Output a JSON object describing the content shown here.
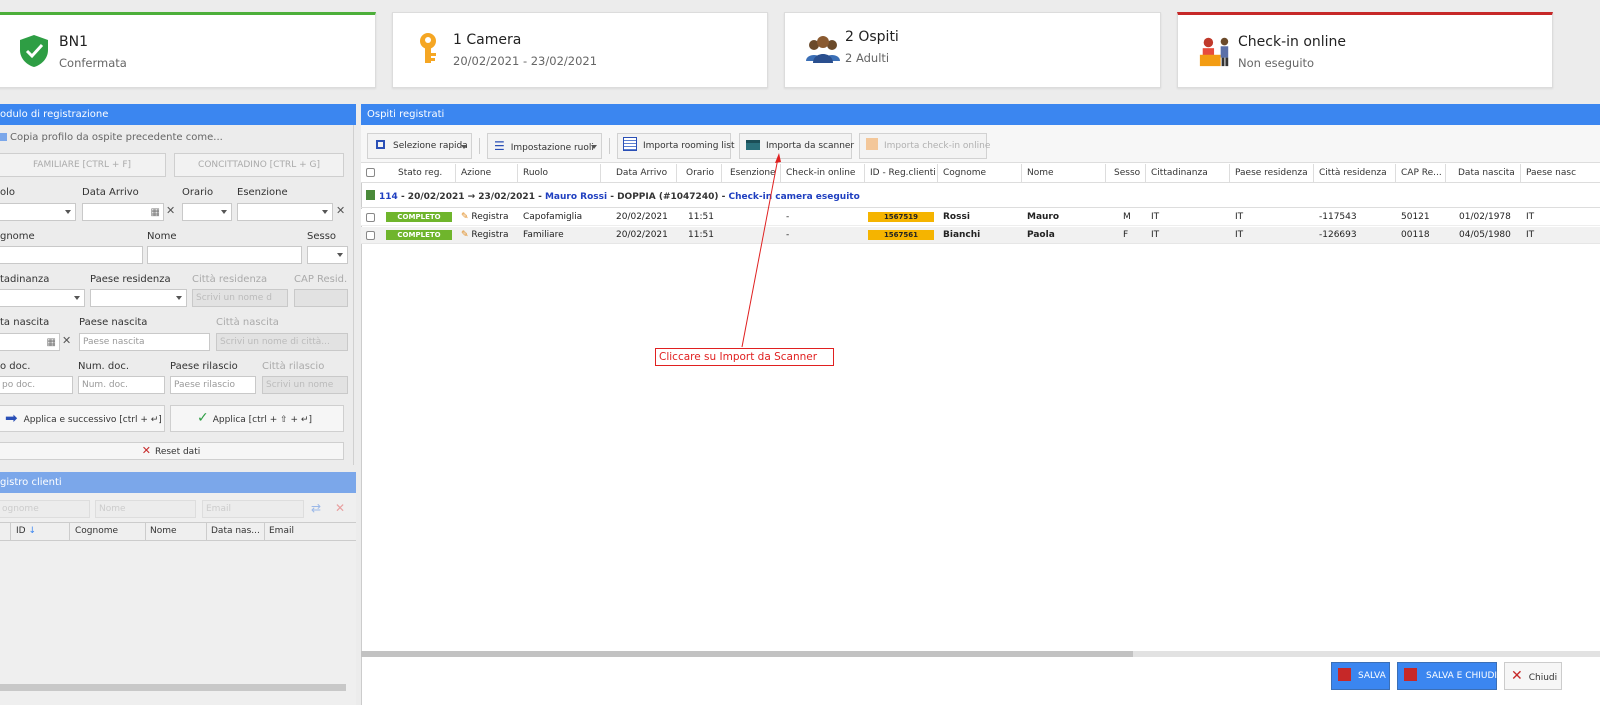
{
  "cards": {
    "booking": {
      "title": "BN1",
      "subtitle": "Confermata",
      "icon": "shield-check-icon"
    },
    "room": {
      "title": "1 Camera",
      "subtitle": "20/02/2021 - 23/02/2021",
      "icon": "key-icon"
    },
    "guests": {
      "title": "2 Ospiti",
      "subtitle": "2 Adulti",
      "icon": "people-icon"
    },
    "checkin": {
      "title": "Check-in online",
      "subtitle": "Non eseguito",
      "icon": "reception-icon"
    }
  },
  "reg_form": {
    "title": "odulo di registrazione",
    "copy_profile": "Copia profilo da ospite precedente come...",
    "familiare_btn": "FAMILIARE [CTRL + F]",
    "concittadino_btn": "CONCITTADINO [CTRL + G]",
    "labels": {
      "ruolo": "olo",
      "data_arrivo": "Data Arrivo",
      "orario": "Orario",
      "esenzione": "Esenzione",
      "cognome": "gnome",
      "nome": "Nome",
      "sesso": "Sesso",
      "cittadinanza": "tadinanza",
      "paese_residenza": "Paese residenza",
      "citta_residenza": "Città residenza",
      "cap_resid": "CAP Resid.",
      "data_nascita": "ta nascita",
      "paese_nascita": "Paese nascita",
      "citta_nascita": "Città nascita",
      "tipo_doc": "o doc.",
      "num_doc": "Num. doc.",
      "paese_rilascio": "Paese rilascio",
      "citta_rilascio": "Città rilascio"
    },
    "placeholders": {
      "citta_residenza": "Scrivi un nome d",
      "paese_nascita": "Paese nascita",
      "citta_nascita": "Scrivi un nome di città...",
      "tipo_doc": "po doc.",
      "num_doc": "Num. doc.",
      "paese_rilascio": "Paese rilascio",
      "citta_rilascio": "Scrivi un nome"
    },
    "apply_next": "Applica e successivo [ctrl + ↵]",
    "apply": "Applica [ctrl + ⇧ + ↵]",
    "reset": "Reset dati"
  },
  "client_registry": {
    "title": "gistro clienti",
    "search_placeholders": {
      "cognome": "ognome",
      "nome": "Nome",
      "email": "Email"
    },
    "columns": [
      "ID",
      "Cognome",
      "Nome",
      "Data nas...",
      "Email"
    ]
  },
  "guests_panel": {
    "title": "Ospiti registrati",
    "toolbar": {
      "quick_select": "Selezione rapida",
      "roles": "Impostazione ruoli",
      "rooming": "Importa rooming list",
      "scanner": "Importa da scanner",
      "checkin_online": "Importa check-in online"
    },
    "columns": [
      "Stato reg.",
      "Azione",
      "Ruolo",
      "Data Arrivo",
      "Orario",
      "Esenzione",
      "Check-in online",
      "ID - Reg.clienti",
      "Cognome",
      "Nome",
      "Sesso",
      "Cittadinanza",
      "Paese residenza",
      "Città residenza",
      "CAP Re...",
      "Data nascita",
      "Paese nasc"
    ],
    "group": {
      "room": "114",
      "dates": "- 20/02/2021 → 23/02/2021 -",
      "guest": "Mauro Rossi",
      "type": "- DOPPIA (#1047240) -",
      "status": "Check-in camera eseguito"
    },
    "rows": [
      {
        "stato": "COMPLETO",
        "azione": "Registra",
        "ruolo": "Capofamiglia",
        "arrivo": "20/02/2021",
        "orario": "11:51",
        "checkin": "-",
        "id": "1567519",
        "cognome": "Rossi",
        "nome": "Mauro",
        "sesso": "M",
        "cittadinanza": "IT",
        "paese_res": "IT",
        "citta_res": "-117543",
        "cap": "50121",
        "nascita": "01/02/1978",
        "paese_nasc": "IT"
      },
      {
        "stato": "COMPLETO",
        "azione": "Registra",
        "ruolo": "Familiare",
        "arrivo": "20/02/2021",
        "orario": "11:51",
        "checkin": "-",
        "id": "1567561",
        "cognome": "Bianchi",
        "nome": "Paola",
        "sesso": "F",
        "cittadinanza": "IT",
        "paese_res": "IT",
        "citta_res": "-126693",
        "cap": "00118",
        "nascita": "04/05/1980",
        "paese_nasc": "IT"
      }
    ]
  },
  "annotation": "Cliccare su Import da Scanner",
  "footer": {
    "save": "SALVA",
    "save_close": "SALVA E CHIUDI",
    "close": "Chiudi"
  },
  "colors": {
    "accent": "#3b86f0",
    "complete": "#6fb52c",
    "id_badge": "#f5b400",
    "annotation": "#e02020"
  }
}
